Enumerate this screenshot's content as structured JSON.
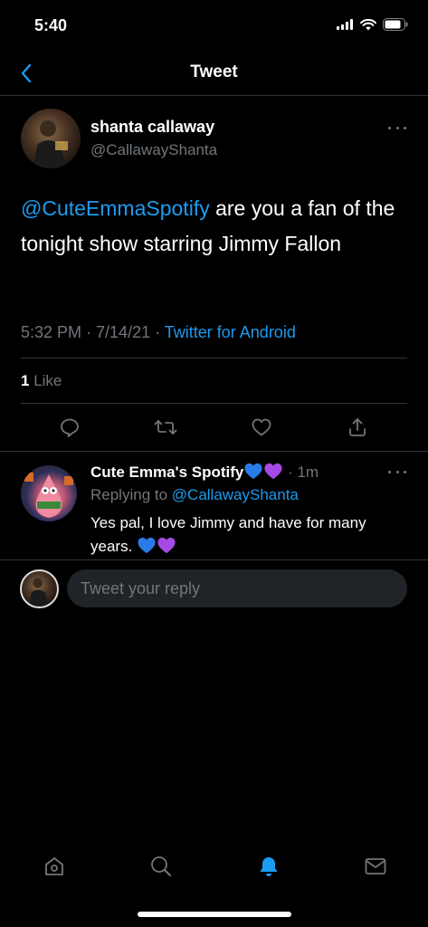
{
  "status_bar": {
    "time": "5:40"
  },
  "nav": {
    "title": "Tweet"
  },
  "tweet": {
    "author_name": "shanta callaway",
    "author_handle": "@CallawayShanta",
    "mention": "@CuteEmmaSpotify",
    "text": " are you a fan of the tonight show starring Jimmy Fallon",
    "time": "5:32 PM · 7/14/21 · ",
    "source": "Twitter for Android",
    "like_count": "1",
    "like_label": " Like"
  },
  "reply": {
    "author_name": "Cute Emma's Spotify",
    "time": " · 1m",
    "replying_label": "Replying to ",
    "replying_handle": "@CallawayShanta",
    "text": "Yes pal, I love Jimmy and have for many years. "
  },
  "compose": {
    "placeholder": "Tweet your reply"
  },
  "colors": {
    "accent": "#1d9bf0",
    "secondary_text": "#71767b",
    "heart_blue": "#2a7bea",
    "heart_purple": "#a64ae6"
  },
  "icons": {
    "tab_home": "home-icon",
    "tab_search": "search-icon",
    "tab_notifications": "bell-icon",
    "tab_messages": "mail-icon"
  }
}
